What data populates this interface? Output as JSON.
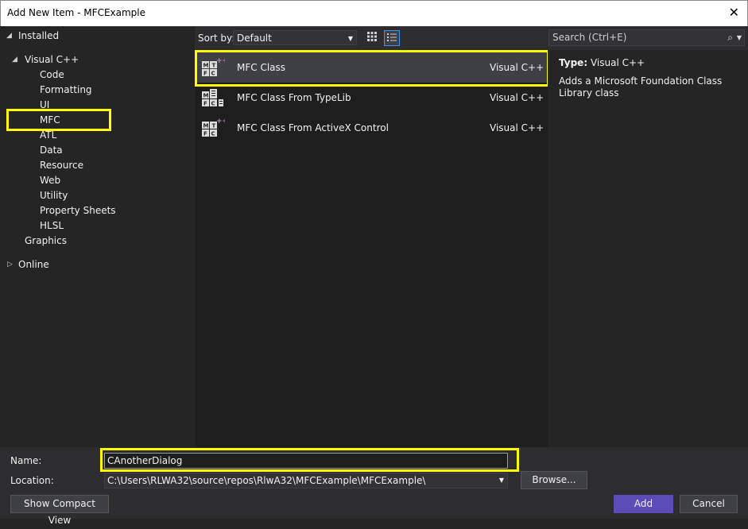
{
  "window": {
    "title": "Add New Item - MFCExample",
    "close_glyph": "✕"
  },
  "tree": {
    "installed": "Installed",
    "visual_cpp": "Visual C++",
    "children": [
      "Code",
      "Formatting",
      "UI",
      "MFC",
      "ATL",
      "Data",
      "Resource",
      "Web",
      "Utility",
      "Property Sheets",
      "HLSL"
    ],
    "graphics": "Graphics",
    "online": "Online",
    "selected": "MFC"
  },
  "toolbar": {
    "sort_label": "Sort by:",
    "sort_value": "Default",
    "grid_view_icon": "grid-view-icon",
    "list_view_icon": "list-view-icon",
    "active_view": "list",
    "search_placeholder": "Search (Ctrl+E)"
  },
  "templates": [
    {
      "name": "MFC Class",
      "lang": "Visual C++",
      "icon": "mfc-class-icon",
      "selected": true
    },
    {
      "name": "MFC Class From TypeLib",
      "lang": "Visual C++",
      "icon": "mfc-typelib-icon",
      "selected": false
    },
    {
      "name": "MFC Class From ActiveX Control",
      "lang": "Visual C++",
      "icon": "mfc-activex-icon",
      "selected": false
    }
  ],
  "details": {
    "type_label": "Type:",
    "type_value": "Visual C++",
    "description": "Adds a Microsoft Foundation Class Library class"
  },
  "form": {
    "name_label": "Name:",
    "name_value": "CAnotherDialog",
    "location_label": "Location:",
    "location_value": "C:\\Users\\RLWA32\\source\\repos\\RlwA32\\MFCExample\\MFCExample\\",
    "browse_label": "Browse...",
    "compact_label": "Show Compact View",
    "add_label": "Add",
    "cancel_label": "Cancel"
  },
  "colors": {
    "highlight": "#ffff00",
    "accent": "#5b4db8",
    "background": "#252526"
  }
}
